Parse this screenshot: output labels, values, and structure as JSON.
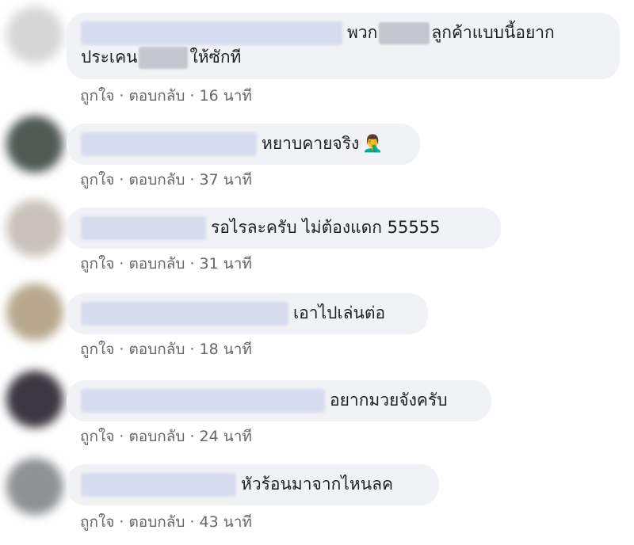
{
  "comments": [
    {
      "text_a": "พวก",
      "text_b": "ลูกค้าแบบนี้อยาก",
      "text_c": "ประเคน",
      "text_d": "ให้ซักที",
      "like": "ถูกใจ",
      "reply": "ตอบกลับ",
      "time": "16 นาที",
      "avatar_color": "#d7d7d7"
    },
    {
      "text": "หยาบคายจริง",
      "emoji": "🤦‍♂️",
      "like": "ถูกใจ",
      "reply": "ตอบกลับ",
      "time": "37 นาที",
      "avatar_color": "#4f5a55"
    },
    {
      "text": "รอไรละครับ ไม่ต้องแดก 55555",
      "like": "ถูกใจ",
      "reply": "ตอบกลับ",
      "time": "31 นาที",
      "avatar_color": "#c9c2bb"
    },
    {
      "text": "เอาไปเล่นต่อ",
      "like": "ถูกใจ",
      "reply": "ตอบกลับ",
      "time": "18 นาที",
      "avatar_color": "#b8a98e"
    },
    {
      "text": "อยากมวยจังครับ",
      "like": "ถูกใจ",
      "reply": "ตอบกลับ",
      "time": "24 นาที",
      "avatar_color": "#3c3740"
    },
    {
      "text": "หัวร้อนมาจากไหนลค",
      "like": "ถูกใจ",
      "reply": "ตอบกลับ",
      "time": "43 นาที",
      "avatar_color": "#8f9194"
    }
  ]
}
